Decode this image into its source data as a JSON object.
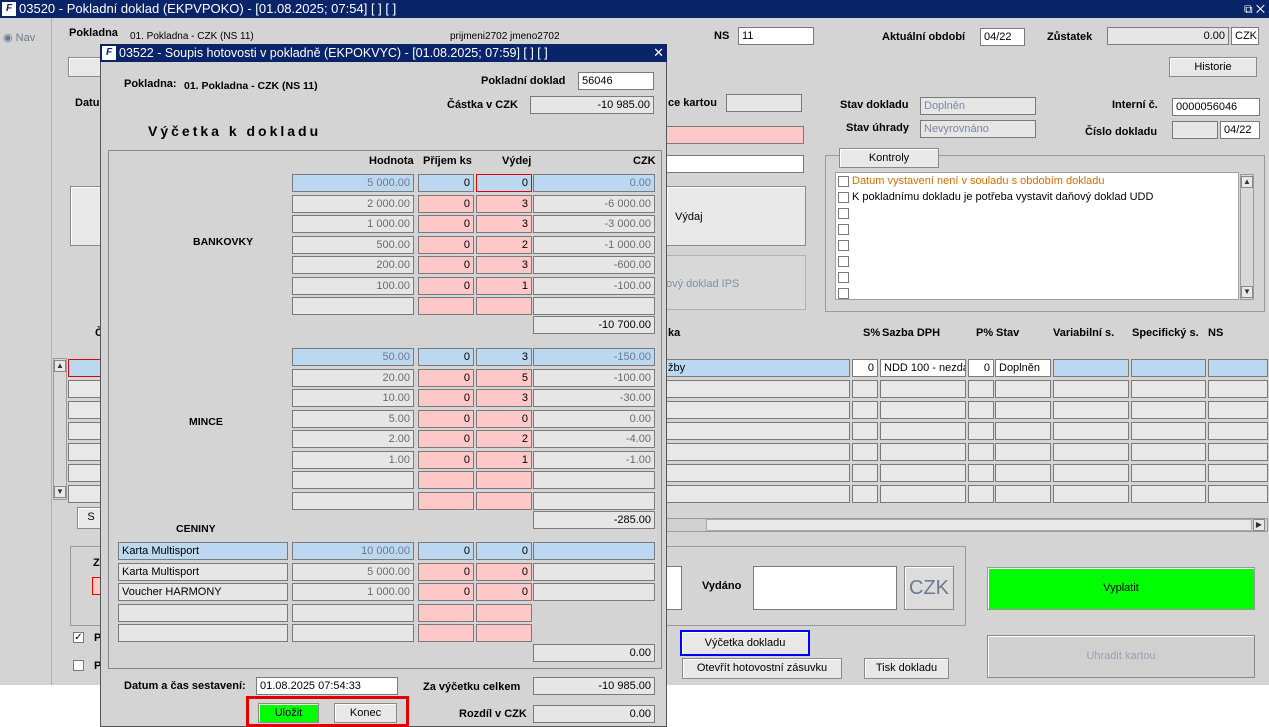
{
  "main": {
    "title": "03520 - Pokladní doklad (EKPVPOKO) - [01.08.2025; 07:54]  [ ]  [ ]",
    "nav_label": "Nav",
    "pokladna_label": "Pokladna",
    "pokladna_value": "01. Pokladna - CZK (NS 11)",
    "user": "prijmeni2702 jmeno2702",
    "ns_label": "NS",
    "ns_value": "11",
    "obdobi_label": "Aktuální období",
    "obdobi_value": "04/22",
    "zustatek_label": "Zůstatek",
    "zustatek_value": "0.00",
    "zustatek_currency": "CZK",
    "historie_button": "Historie",
    "datum_label_partial": "Datu",
    "karta_label_partial": "ce kartou",
    "stav_dokladu_label": "Stav dokladu",
    "stav_dokladu_value": "Doplněn",
    "stav_uhrady_label": "Stav úhrady",
    "stav_uhrady_value": "Nevyrovnáno",
    "interni_label": "Interní č.",
    "interni_value": "0000056046",
    "cislo_label": "Číslo dokladu",
    "cislo_value": "04/22",
    "kontroly_button": "Kontroly",
    "kontroly_items": [
      "Datum vystavení není v souladu s obdobím dokladu",
      "K pokladnímu dokladu je potřeba vystavit daňový doklad UDD"
    ],
    "vydaj_button": "Výdaj",
    "ips_text": "ový doklad IPS",
    "grid_headers": {
      "ka": "ka",
      "s_pct": "S%",
      "sazba": "Sazba DPH",
      "p_pct": "P%",
      "stav": "Stav",
      "var": "Variabilní s.",
      "spec": "Specifický s.",
      "ns": "NS"
    },
    "grid_row1": {
      "text": "žby",
      "s": "0",
      "sazba": "NDD 100 - nezda",
      "p": "0",
      "stav": "Doplněn"
    },
    "vydano_label": "Vydáno",
    "currency_button": "CZK",
    "vyplatit_button": "Vyplatit",
    "vycetka_button": "Výčetka dokladu",
    "zasuvka_button": "Otevřít hotovostní zásuvku",
    "tisk_button": "Tisk dokladu",
    "uhradit_button": "Uhradit kartou",
    "left_cut_c": "Č",
    "left_cut_s": "S",
    "left_cut_z": "Z",
    "left_cut_p1": "P",
    "left_cut_p2": "P"
  },
  "dialog": {
    "title": "03522 - Soupis hotovosti v pokladně (EKPOKVYC) - [01.08.2025; 07:59]  [ ]  [ ]",
    "pokladna_label": "Pokladna:",
    "pokladna_value": "01. Pokladna - CZK (NS 11)",
    "doklad_label": "Pokladní doklad",
    "doklad_value": "56046",
    "castka_label": "Částka v CZK",
    "castka_value": "-10 985.00",
    "heading": "Výčetka k dokladu",
    "col_hodnota": "Hodnota",
    "col_prijem": "Příjem ks",
    "col_vydej": "Výdej",
    "col_czk": "CZK",
    "bankovky_label": "BANKOVKY",
    "bankovky": [
      {
        "hodnota": "5 000.00",
        "prijem": "0",
        "vydej": "0",
        "czk": "0.00"
      },
      {
        "hodnota": "2 000.00",
        "prijem": "0",
        "vydej": "3",
        "czk": "-6 000.00"
      },
      {
        "hodnota": "1 000.00",
        "prijem": "0",
        "vydej": "3",
        "czk": "-3 000.00"
      },
      {
        "hodnota": "500.00",
        "prijem": "0",
        "vydej": "2",
        "czk": "-1 000.00"
      },
      {
        "hodnota": "200.00",
        "prijem": "0",
        "vydej": "3",
        "czk": "-600.00"
      },
      {
        "hodnota": "100.00",
        "prijem": "0",
        "vydej": "1",
        "czk": "-100.00"
      }
    ],
    "bankovky_total": "-10 700.00",
    "mince_label": "MINCE",
    "mince": [
      {
        "hodnota": "50.00",
        "prijem": "0",
        "vydej": "3",
        "czk": "-150.00"
      },
      {
        "hodnota": "20.00",
        "prijem": "0",
        "vydej": "5",
        "czk": "-100.00"
      },
      {
        "hodnota": "10.00",
        "prijem": "0",
        "vydej": "3",
        "czk": "-30.00"
      },
      {
        "hodnota": "5.00",
        "prijem": "0",
        "vydej": "0",
        "czk": "0.00"
      },
      {
        "hodnota": "2.00",
        "prijem": "0",
        "vydej": "2",
        "czk": "-4.00"
      },
      {
        "hodnota": "1.00",
        "prijem": "0",
        "vydej": "1",
        "czk": "-1.00"
      }
    ],
    "mince_total": "-285.00",
    "ceniny_label": "CENINY",
    "ceniny": [
      {
        "name": "Karta Multisport",
        "hodnota": "10 000.00",
        "prijem": "0",
        "vydej": "0"
      },
      {
        "name": "Karta Multisport",
        "hodnota": "5 000.00",
        "prijem": "0",
        "vydej": "0"
      },
      {
        "name": "Voucher HARMONY",
        "hodnota": "1 000.00",
        "prijem": "0",
        "vydej": "0"
      }
    ],
    "ceniny_total": "0.00",
    "datum_label": "Datum a čas sestavení:",
    "datum_value": "01.08.2025 07:54:33",
    "celkem_label": "Za výčetku celkem",
    "celkem_value": "-10 985.00",
    "rozdil_label": "Rozdíl v CZK",
    "rozdil_value": "0.00",
    "ulozit_button": "Uložit",
    "konec_button": "Konec"
  },
  "colors": {
    "accent_blue": "#0a246a",
    "highlight_red": "#e00000",
    "highlight_blue": "#0000ff",
    "green": "#00ff00"
  }
}
